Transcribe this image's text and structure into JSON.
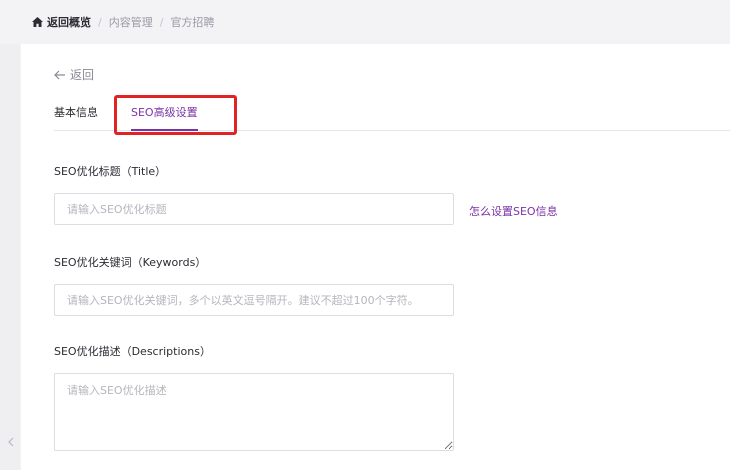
{
  "breadcrumb": {
    "home": "返回概览",
    "separator": "/",
    "items": [
      "内容管理",
      "官方招聘"
    ]
  },
  "card": {
    "back_label": "返回",
    "tabs": [
      {
        "label": "基本信息",
        "active": false
      },
      {
        "label": "SEO高级设置",
        "active": true
      }
    ],
    "fields": {
      "title": {
        "label": "SEO优化标题（Title）",
        "placeholder": "请输入SEO优化标题",
        "value": ""
      },
      "keywords": {
        "label": "SEO优化关键词（Keywords）",
        "placeholder": "请输入SEO优化关键词，多个以英文逗号隔开。建议不超过100个字符。",
        "value": ""
      },
      "description": {
        "label": "SEO优化描述（Descriptions）",
        "placeholder": "请输入SEO优化描述",
        "value": ""
      }
    },
    "help_link": "怎么设置SEO信息"
  },
  "colors": {
    "accent": "#7b32a8",
    "highlight": "#e02424",
    "background": "#f3f3f5"
  },
  "icons": {
    "home": "home-icon",
    "back": "arrow-left-icon",
    "collapse": "chevron-left-icon"
  }
}
